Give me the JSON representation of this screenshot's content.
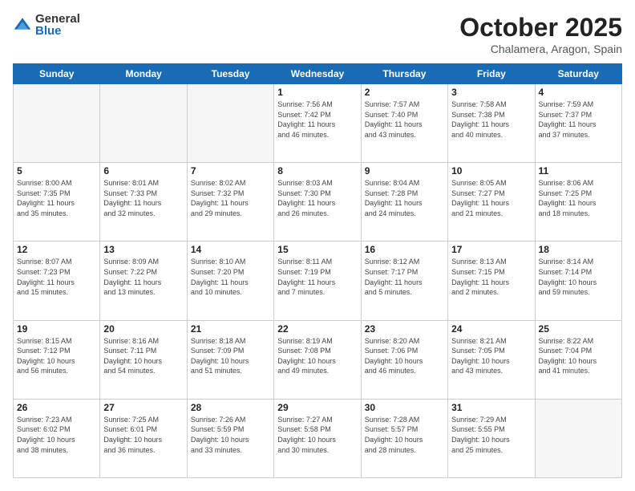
{
  "header": {
    "logo_general": "General",
    "logo_blue": "Blue",
    "month": "October 2025",
    "location": "Chalamera, Aragon, Spain"
  },
  "days_of_week": [
    "Sunday",
    "Monday",
    "Tuesday",
    "Wednesday",
    "Thursday",
    "Friday",
    "Saturday"
  ],
  "weeks": [
    [
      {
        "num": "",
        "info": ""
      },
      {
        "num": "",
        "info": ""
      },
      {
        "num": "",
        "info": ""
      },
      {
        "num": "1",
        "info": "Sunrise: 7:56 AM\nSunset: 7:42 PM\nDaylight: 11 hours\nand 46 minutes."
      },
      {
        "num": "2",
        "info": "Sunrise: 7:57 AM\nSunset: 7:40 PM\nDaylight: 11 hours\nand 43 minutes."
      },
      {
        "num": "3",
        "info": "Sunrise: 7:58 AM\nSunset: 7:38 PM\nDaylight: 11 hours\nand 40 minutes."
      },
      {
        "num": "4",
        "info": "Sunrise: 7:59 AM\nSunset: 7:37 PM\nDaylight: 11 hours\nand 37 minutes."
      }
    ],
    [
      {
        "num": "5",
        "info": "Sunrise: 8:00 AM\nSunset: 7:35 PM\nDaylight: 11 hours\nand 35 minutes."
      },
      {
        "num": "6",
        "info": "Sunrise: 8:01 AM\nSunset: 7:33 PM\nDaylight: 11 hours\nand 32 minutes."
      },
      {
        "num": "7",
        "info": "Sunrise: 8:02 AM\nSunset: 7:32 PM\nDaylight: 11 hours\nand 29 minutes."
      },
      {
        "num": "8",
        "info": "Sunrise: 8:03 AM\nSunset: 7:30 PM\nDaylight: 11 hours\nand 26 minutes."
      },
      {
        "num": "9",
        "info": "Sunrise: 8:04 AM\nSunset: 7:28 PM\nDaylight: 11 hours\nand 24 minutes."
      },
      {
        "num": "10",
        "info": "Sunrise: 8:05 AM\nSunset: 7:27 PM\nDaylight: 11 hours\nand 21 minutes."
      },
      {
        "num": "11",
        "info": "Sunrise: 8:06 AM\nSunset: 7:25 PM\nDaylight: 11 hours\nand 18 minutes."
      }
    ],
    [
      {
        "num": "12",
        "info": "Sunrise: 8:07 AM\nSunset: 7:23 PM\nDaylight: 11 hours\nand 15 minutes."
      },
      {
        "num": "13",
        "info": "Sunrise: 8:09 AM\nSunset: 7:22 PM\nDaylight: 11 hours\nand 13 minutes."
      },
      {
        "num": "14",
        "info": "Sunrise: 8:10 AM\nSunset: 7:20 PM\nDaylight: 11 hours\nand 10 minutes."
      },
      {
        "num": "15",
        "info": "Sunrise: 8:11 AM\nSunset: 7:19 PM\nDaylight: 11 hours\nand 7 minutes."
      },
      {
        "num": "16",
        "info": "Sunrise: 8:12 AM\nSunset: 7:17 PM\nDaylight: 11 hours\nand 5 minutes."
      },
      {
        "num": "17",
        "info": "Sunrise: 8:13 AM\nSunset: 7:15 PM\nDaylight: 11 hours\nand 2 minutes."
      },
      {
        "num": "18",
        "info": "Sunrise: 8:14 AM\nSunset: 7:14 PM\nDaylight: 10 hours\nand 59 minutes."
      }
    ],
    [
      {
        "num": "19",
        "info": "Sunrise: 8:15 AM\nSunset: 7:12 PM\nDaylight: 10 hours\nand 56 minutes."
      },
      {
        "num": "20",
        "info": "Sunrise: 8:16 AM\nSunset: 7:11 PM\nDaylight: 10 hours\nand 54 minutes."
      },
      {
        "num": "21",
        "info": "Sunrise: 8:18 AM\nSunset: 7:09 PM\nDaylight: 10 hours\nand 51 minutes."
      },
      {
        "num": "22",
        "info": "Sunrise: 8:19 AM\nSunset: 7:08 PM\nDaylight: 10 hours\nand 49 minutes."
      },
      {
        "num": "23",
        "info": "Sunrise: 8:20 AM\nSunset: 7:06 PM\nDaylight: 10 hours\nand 46 minutes."
      },
      {
        "num": "24",
        "info": "Sunrise: 8:21 AM\nSunset: 7:05 PM\nDaylight: 10 hours\nand 43 minutes."
      },
      {
        "num": "25",
        "info": "Sunrise: 8:22 AM\nSunset: 7:04 PM\nDaylight: 10 hours\nand 41 minutes."
      }
    ],
    [
      {
        "num": "26",
        "info": "Sunrise: 7:23 AM\nSunset: 6:02 PM\nDaylight: 10 hours\nand 38 minutes."
      },
      {
        "num": "27",
        "info": "Sunrise: 7:25 AM\nSunset: 6:01 PM\nDaylight: 10 hours\nand 36 minutes."
      },
      {
        "num": "28",
        "info": "Sunrise: 7:26 AM\nSunset: 5:59 PM\nDaylight: 10 hours\nand 33 minutes."
      },
      {
        "num": "29",
        "info": "Sunrise: 7:27 AM\nSunset: 5:58 PM\nDaylight: 10 hours\nand 30 minutes."
      },
      {
        "num": "30",
        "info": "Sunrise: 7:28 AM\nSunset: 5:57 PM\nDaylight: 10 hours\nand 28 minutes."
      },
      {
        "num": "31",
        "info": "Sunrise: 7:29 AM\nSunset: 5:55 PM\nDaylight: 10 hours\nand 25 minutes."
      },
      {
        "num": "",
        "info": ""
      }
    ]
  ]
}
